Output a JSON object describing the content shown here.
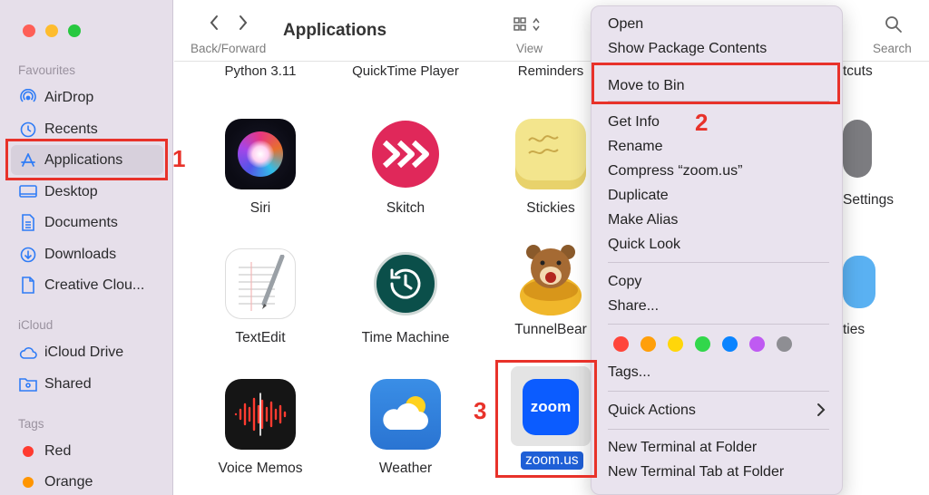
{
  "sidebar": {
    "favourites_heading": "Favourites",
    "icloud_heading": "iCloud",
    "tags_heading": "Tags",
    "items": [
      {
        "label": "AirDrop",
        "icon": "airdrop-icon"
      },
      {
        "label": "Recents",
        "icon": "clock-icon"
      },
      {
        "label": "Applications",
        "icon": "applications-icon"
      },
      {
        "label": "Desktop",
        "icon": "desktop-icon"
      },
      {
        "label": "Documents",
        "icon": "document-icon"
      },
      {
        "label": "Downloads",
        "icon": "download-icon"
      },
      {
        "label": "Creative Clou...",
        "icon": "file-icon"
      },
      {
        "label": "iCloud Drive",
        "icon": "cloud-icon"
      },
      {
        "label": "Shared",
        "icon": "shared-folder-icon"
      },
      {
        "label": "Red",
        "color": "#ff3b30"
      },
      {
        "label": "Orange",
        "color": "#ff9500"
      }
    ]
  },
  "toolbar": {
    "title": "Applications",
    "nav_label": "Back/Forward",
    "view_label": "View",
    "search_label": "Search"
  },
  "grid": {
    "top_row": [
      "Python 3.11",
      "QuickTime Player",
      "Reminders"
    ],
    "apps": [
      {
        "name": "Siri"
      },
      {
        "name": "Skitch"
      },
      {
        "name": "Stickies"
      },
      {
        "name": "TextEdit"
      },
      {
        "name": "Time Machine"
      },
      {
        "name": "TunnelBear"
      },
      {
        "name": "Voice Memos"
      },
      {
        "name": "Weather"
      },
      {
        "name": "zoom.us"
      }
    ],
    "zoom_logo_text": "zoom",
    "partial_right": {
      "top": "tcuts",
      "row1": "Settings",
      "row2": "ties"
    }
  },
  "context_menu": {
    "items": {
      "open": "Open",
      "show_package": "Show Package Contents",
      "move_to_bin": "Move to Bin",
      "get_info": "Get Info",
      "rename": "Rename",
      "compress": "Compress “zoom.us”",
      "duplicate": "Duplicate",
      "make_alias": "Make Alias",
      "quick_look": "Quick Look",
      "copy": "Copy",
      "share": "Share...",
      "tags": "Tags...",
      "quick_actions": "Quick Actions",
      "new_terminal": "New Terminal at Folder",
      "new_terminal_tab": "New Terminal Tab at Folder"
    },
    "tag_colors": [
      "#ff453a",
      "#ff9f0a",
      "#ffd60a",
      "#32d74b",
      "#0a84ff",
      "#bf5af2",
      "#8e8e93"
    ]
  },
  "annotations": {
    "step1": "1",
    "step2": "2",
    "step3": "3"
  },
  "colors": {
    "annotation": "#e8322a",
    "accent": "#2f7cf6"
  }
}
